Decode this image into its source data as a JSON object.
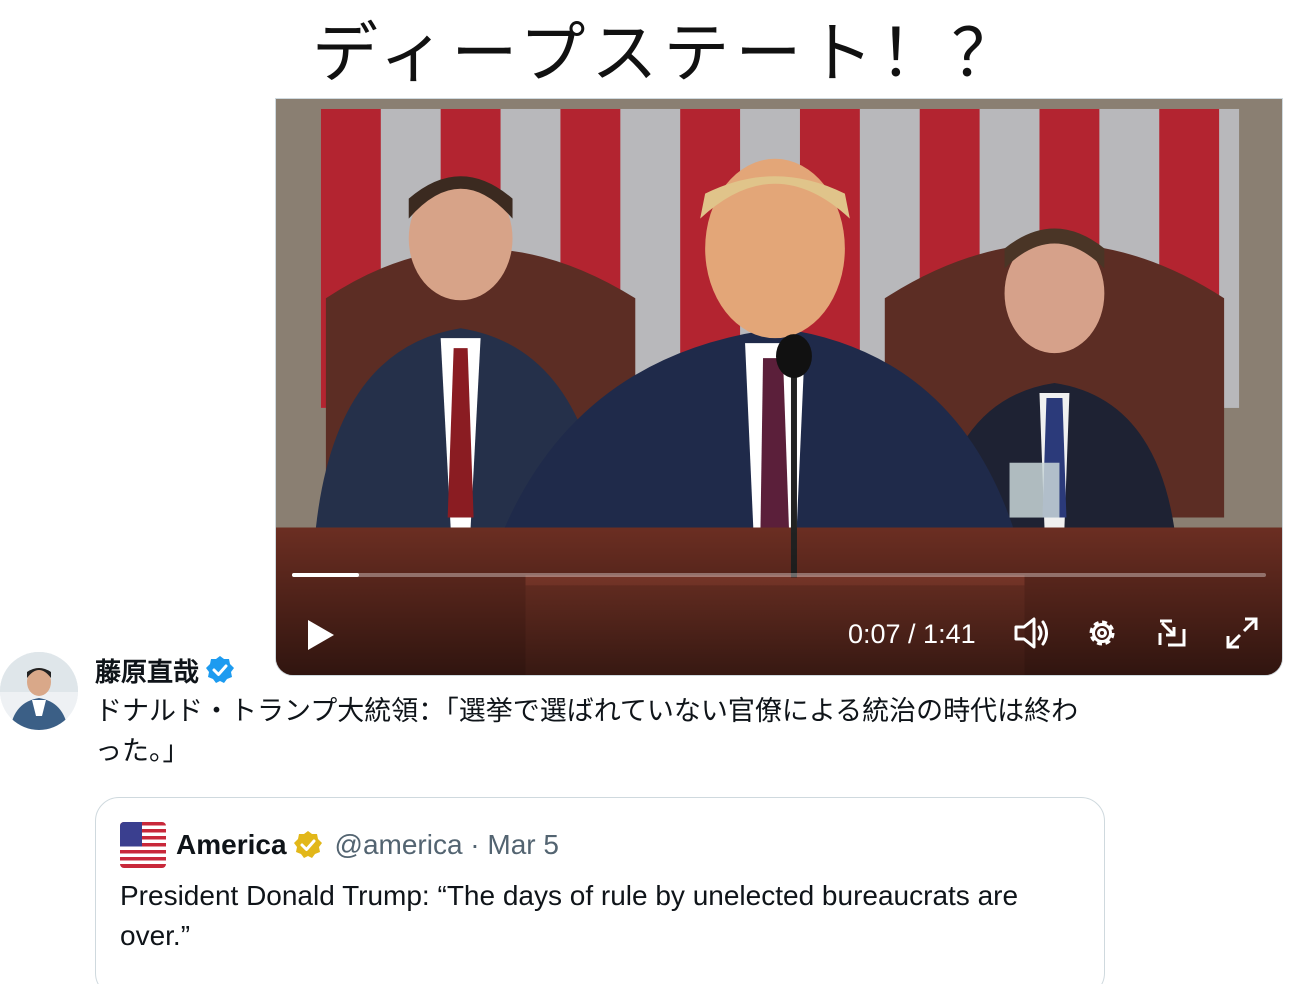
{
  "headline": "ディープステート！？",
  "video": {
    "time_display": "0:07 / 1:41",
    "progress": 0.069,
    "controls": [
      "play-icon",
      "volume-icon",
      "gear-icon",
      "pip-icon",
      "fullscreen-icon"
    ]
  },
  "tweet": {
    "author_name": "藤原直哉",
    "verified": "blue-check",
    "text": "ドナルド・トランプ大統領：「選挙で選ばれていない官僚による統治の時代は終わった。」"
  },
  "quoted_tweet": {
    "author_name": "America",
    "verified": "gold-check",
    "handle_date": "@america · Mar 5",
    "text": "President Donald Trump: “The days of rule by unelected bureaucrats are over.”"
  },
  "colors": {
    "verified_blue": "#1d9bf0",
    "verified_gold": "#e2b719",
    "secondary_text": "#536471",
    "border": "#cfd9de"
  }
}
